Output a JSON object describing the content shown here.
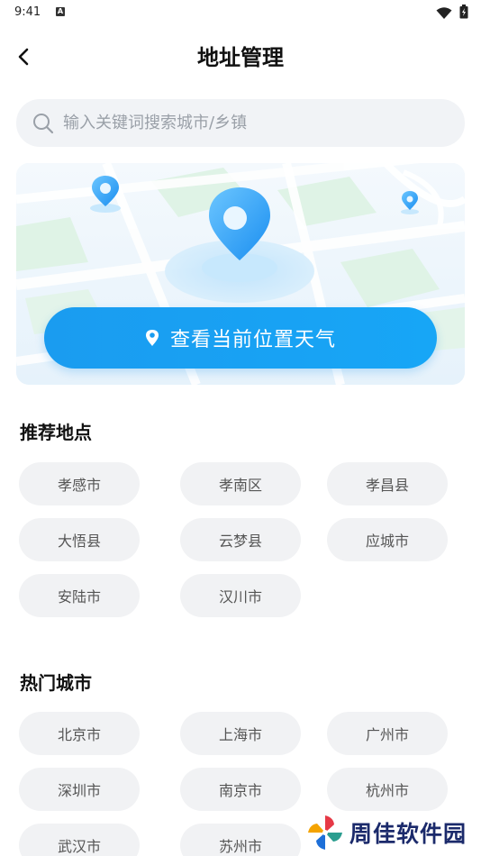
{
  "status_bar": {
    "time": "9:41"
  },
  "header": {
    "title": "地址管理"
  },
  "search": {
    "placeholder": "输入关键词搜索城市/乡镇"
  },
  "locate": {
    "label": "查看当前位置天气"
  },
  "recommended": {
    "title": "推荐地点",
    "items": [
      "孝感市",
      "孝南区",
      "孝昌县",
      "大悟县",
      "云梦县",
      "应城市",
      "安陆市",
      "汉川市"
    ]
  },
  "hot": {
    "title": "热门城市",
    "items": [
      "北京市",
      "上海市",
      "广州市",
      "深圳市",
      "南京市",
      "杭州市",
      "武汉市",
      "苏州市"
    ]
  },
  "watermark": {
    "text": "周佳软件园"
  },
  "colors": {
    "accent": "#1a9cf0",
    "chip_bg": "#f1f2f4",
    "search_bg": "#f1f3f6"
  }
}
